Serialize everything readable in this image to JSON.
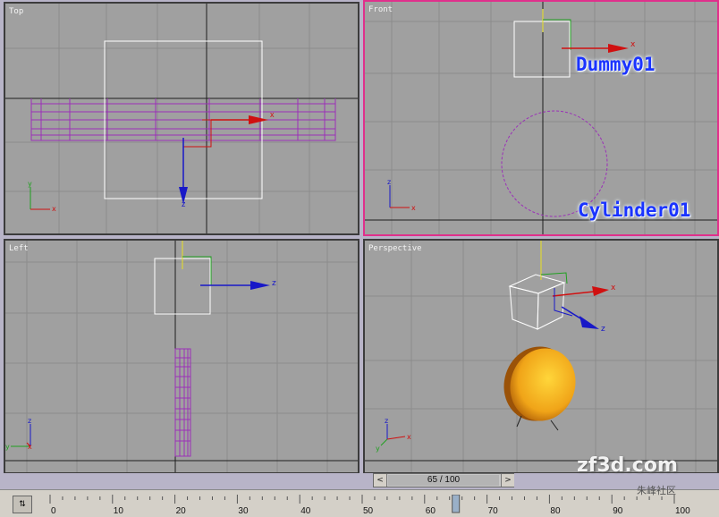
{
  "viewports": {
    "top": {
      "label": "Top"
    },
    "front": {
      "label": "Front",
      "dummy_label": "Dummy01",
      "cylinder_label": "Cylinder01"
    },
    "left": {
      "label": "Left"
    },
    "perspective": {
      "label": "Perspective"
    }
  },
  "gizmo_axes": {
    "x": "x",
    "y": "y",
    "z": "z"
  },
  "frame_slider": {
    "readout": "65 / 100",
    "prev_icon": "<",
    "next_icon": ">",
    "current": 65,
    "total": 100
  },
  "timeline": {
    "ticks": [
      "0",
      "10",
      "20",
      "30",
      "40",
      "50",
      "60",
      "70",
      "80",
      "90",
      "100"
    ],
    "key_icon": "key-filter-icon"
  },
  "watermark": {
    "text": "zf3d.com",
    "sub": "朱峰社区"
  },
  "colors": {
    "viewport_bg": "#a0a0a0",
    "grid": "#8c8c8c",
    "axis_line": "#1e1e1e",
    "active_border": "#e0308c",
    "wire_purple": "#9b30b8",
    "dummy_white": "#ffffff",
    "x_red": "#d01010",
    "z_blue": "#1818c8",
    "y_green": "#20a020"
  }
}
